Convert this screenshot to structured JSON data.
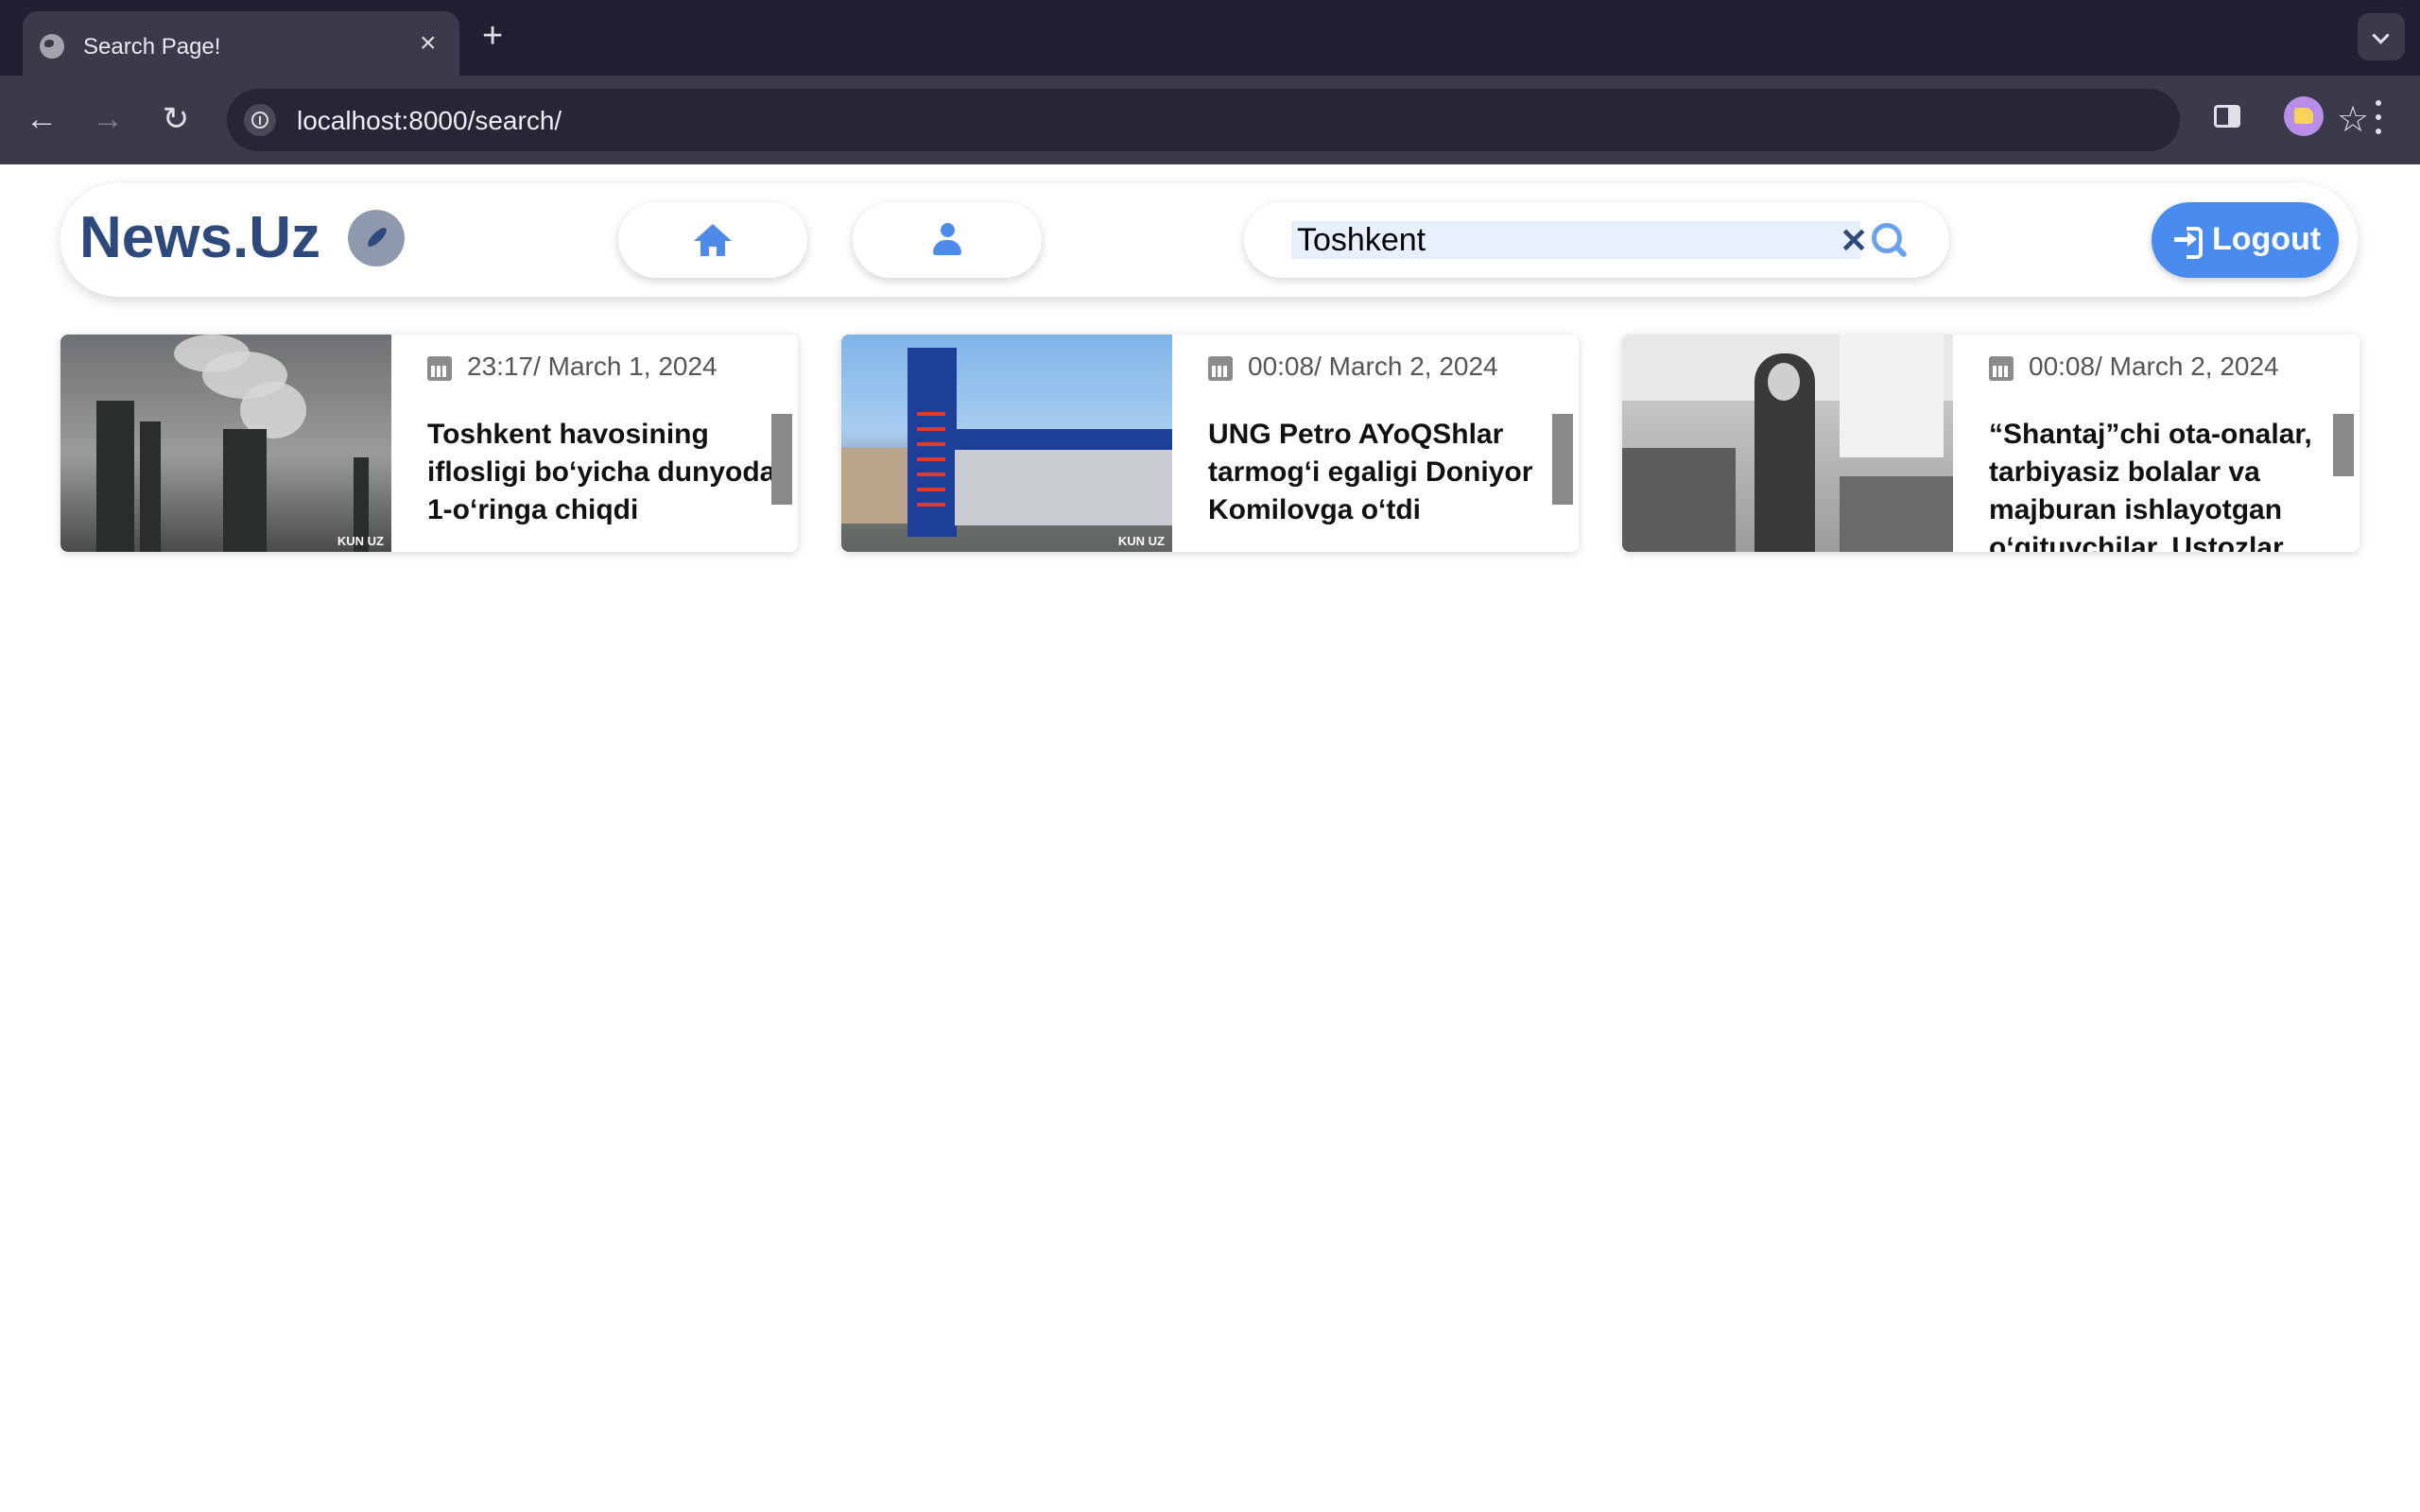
{
  "browser": {
    "tab_title": "Search Page!",
    "tab_close": "×",
    "new_tab": "+",
    "url": "localhost:8000/search/"
  },
  "header": {
    "logo": "News.Uz",
    "search_value": "Toshkent",
    "clear_symbol": "✕",
    "logout_label": "Logout"
  },
  "icons": {
    "favicon": "globe-icon",
    "home": "home-icon",
    "profile": "user-icon",
    "search": "search-icon",
    "logout": "logout-icon",
    "calendar": "calendar-icon",
    "logo": "compass-icon"
  },
  "colors": {
    "brand": "#2e4a7d",
    "accent": "#4a8bf0",
    "icon_blue": "#4e8be8"
  },
  "news": [
    {
      "date": "23:17/ March 1, 2024",
      "title": "Toshkent havosining iflosligi bo‘yicha dunyoda 1-o‘ringa chiqdi",
      "badge": "KUN UZ"
    },
    {
      "date": "00:08/ March 2, 2024",
      "title": "UNG Petro AYoQShlar tarmog‘i egaligi Doniyor Komilovga o‘tdi",
      "badge": "KUN UZ"
    },
    {
      "date": "00:08/ March 2, 2024",
      "title": "“Shantaj”chi ota-onalar, tarbiyasiz bolalar va majburan ishlayotgan o‘qituvchilar. Ustozlar"
    }
  ]
}
